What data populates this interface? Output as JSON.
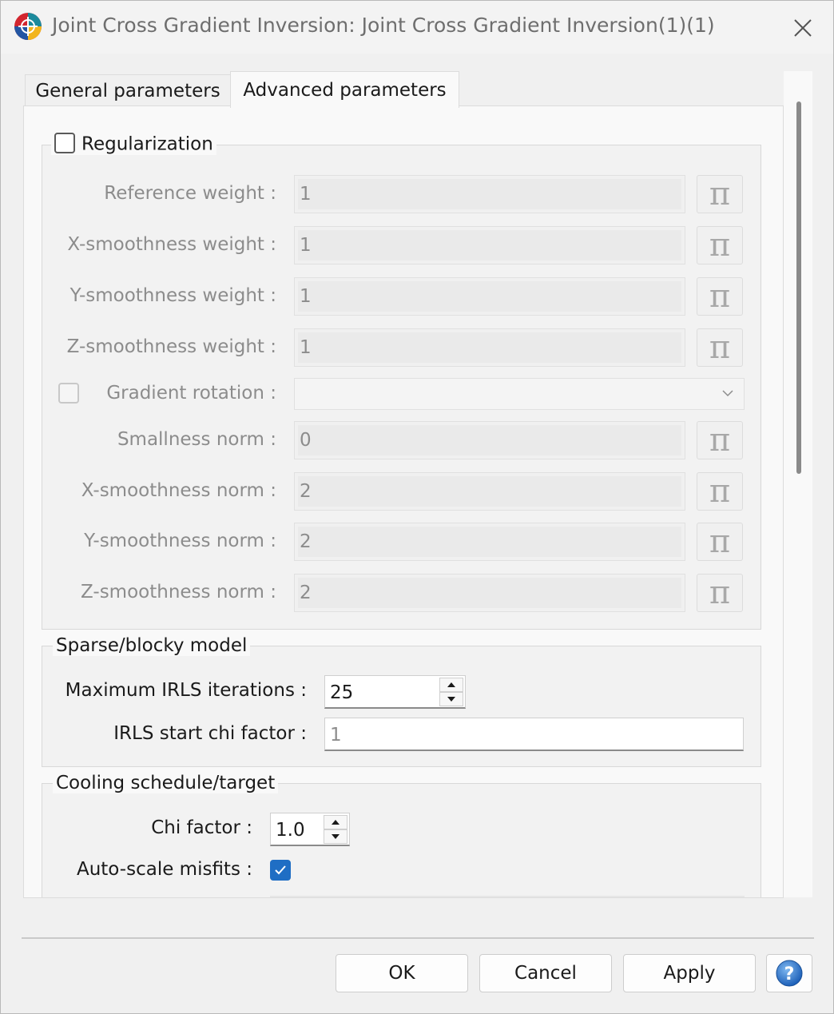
{
  "window": {
    "title": "Joint Cross Gradient Inversion: Joint Cross Gradient Inversion(1)(1)"
  },
  "tabs": [
    {
      "label": "General parameters",
      "active": false
    },
    {
      "label": "Advanced parameters",
      "active": true
    }
  ],
  "regularization": {
    "title": "Regularization",
    "checked": false,
    "rows": [
      {
        "label": "Reference weight :",
        "value": "1"
      },
      {
        "label": "X-smoothness weight :",
        "value": "1"
      },
      {
        "label": "Y-smoothness weight :",
        "value": "1"
      },
      {
        "label": "Z-smoothness weight :",
        "value": "1"
      }
    ],
    "gradient_rotation": {
      "label": "Gradient rotation :",
      "value": ""
    },
    "norm_rows": [
      {
        "label": "Smallness norm :",
        "value": "0"
      },
      {
        "label": "X-smoothness norm :",
        "value": "2"
      },
      {
        "label": "Y-smoothness norm :",
        "value": "2"
      },
      {
        "label": "Z-smoothness norm :",
        "value": "2"
      }
    ],
    "pi_symbol": "π"
  },
  "sparse": {
    "title": "Sparse/blocky model",
    "max_irls_label": "Maximum IRLS iterations :",
    "max_irls_value": "25",
    "irls_chi_label": "IRLS start chi factor :",
    "irls_chi_value": "1"
  },
  "cooling": {
    "title": "Cooling schedule/target",
    "chi_label": "Chi factor :",
    "chi_value": "1.0",
    "autoscale_label": "Auto-scale misfits :",
    "autoscale_checked": true
  },
  "buttons": {
    "ok": "OK",
    "cancel": "Cancel",
    "apply": "Apply",
    "help": "?"
  },
  "colors": {
    "accent": "#1f6ec4",
    "disabled_text": "#8c8c8c"
  }
}
